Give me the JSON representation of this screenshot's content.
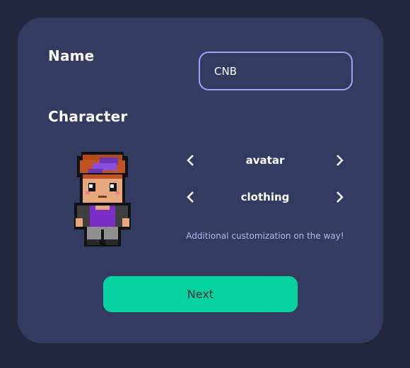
{
  "name_section": {
    "title": "Name",
    "input_value": "CNB",
    "input_placeholder": ""
  },
  "character_section": {
    "title": "Character",
    "selectors": [
      {
        "label": "avatar",
        "prev_icon": "chevron-left-icon",
        "next_icon": "chevron-right-icon"
      },
      {
        "label": "clothing",
        "prev_icon": "chevron-left-icon",
        "next_icon": "chevron-right-icon"
      }
    ],
    "note": "Additional customization on the way!"
  },
  "next_button": {
    "label": "Next"
  },
  "colors": {
    "page_background": "#23283f",
    "card_background": "#333b61",
    "input_border": "#9aa6ee",
    "accent": "#06d3a0",
    "note_text": "#aeb9f4"
  }
}
